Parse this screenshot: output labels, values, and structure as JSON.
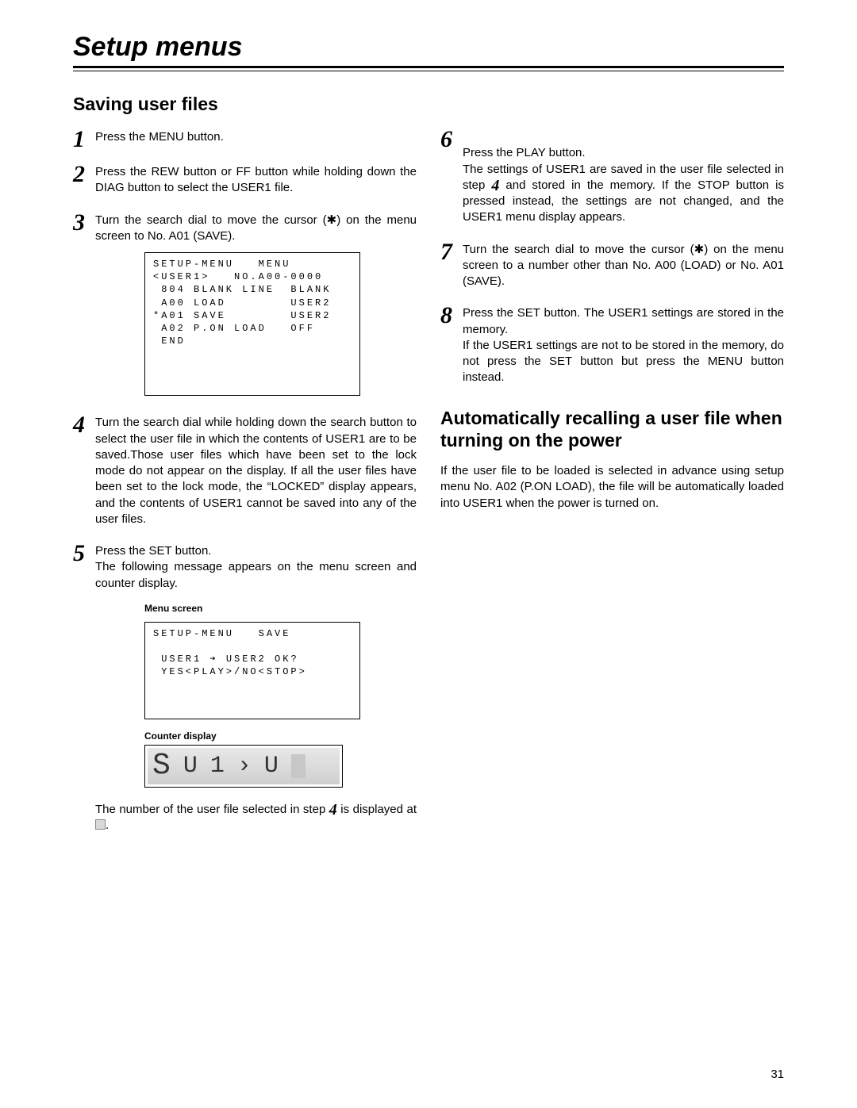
{
  "header": {
    "title": "Setup menus"
  },
  "section1": {
    "title": "Saving user files"
  },
  "left": {
    "s1": {
      "num": "1",
      "text": "Press the MENU button."
    },
    "s2": {
      "num": "2",
      "text": "Press the REW button or FF button while holding down the DIAG button to select the USER1 file."
    },
    "s3": {
      "num": "3",
      "text_a": "Turn the search dial to move the cursor (",
      "text_b": ") on the menu screen to No. A01 (SAVE).",
      "menu": "SETUP-MENU   MENU\n<USER1>   NO.A00-0000\n 804 BLANK LINE  BLANK\n A00 LOAD        USER2\n*A01 SAVE        USER2\n A02 P.ON LOAD   OFF\n END"
    },
    "s4": {
      "num": "4",
      "text": "Turn the search dial while holding down the search button to select the user file in which the contents of USER1 are to be saved.Those user files which have been set to the lock mode do not appear on the display. If all the user files have been set to the lock mode, the “LOCKED” display appears, and the contents of USER1 cannot be saved into any of the user files."
    },
    "s5": {
      "num": "5",
      "text": "Press the SET button.\nThe following message appears on the menu screen and counter display.",
      "cap1": "Menu screen",
      "menu": "SETUP-MENU   SAVE\n\n USER1 ➔ USER2 OK?\n YES<PLAY>/NO<STOP>",
      "cap2": "Counter display",
      "counter_hint": "S U1 > U2",
      "tail_a": "The number of the user file selected in step ",
      "tail_num": "4",
      "tail_b": " is displayed at ",
      "tail_c": "."
    }
  },
  "right": {
    "s6": {
      "num": "6",
      "a": "Press the PLAY button.\nThe settings of USER1 are saved in the user file selected in step ",
      "ref": "4",
      "b": " and stored in the memory. If the STOP button is pressed instead, the settings are not changed, and the USER1 menu display appears."
    },
    "s7": {
      "num": "7",
      "a": "Turn the search dial to move the cursor (",
      "b": ") on the menu screen to a number other than No. A00 (LOAD) or No. A01 (SAVE)."
    },
    "s8": {
      "num": "8",
      "text": "Press the SET button. The USER1 settings are stored in the memory.\nIf the USER1 settings are not to be stored in the memory, do not press the SET button but press the MENU button instead."
    },
    "section2": {
      "title": "Automatically recalling a user file when turning on the power"
    },
    "para": "If the user file to be loaded is selected in advance using setup menu No. A02 (P.ON LOAD), the file will be automatically loaded into USER1 when the power is turned on."
  },
  "page_number": "31"
}
